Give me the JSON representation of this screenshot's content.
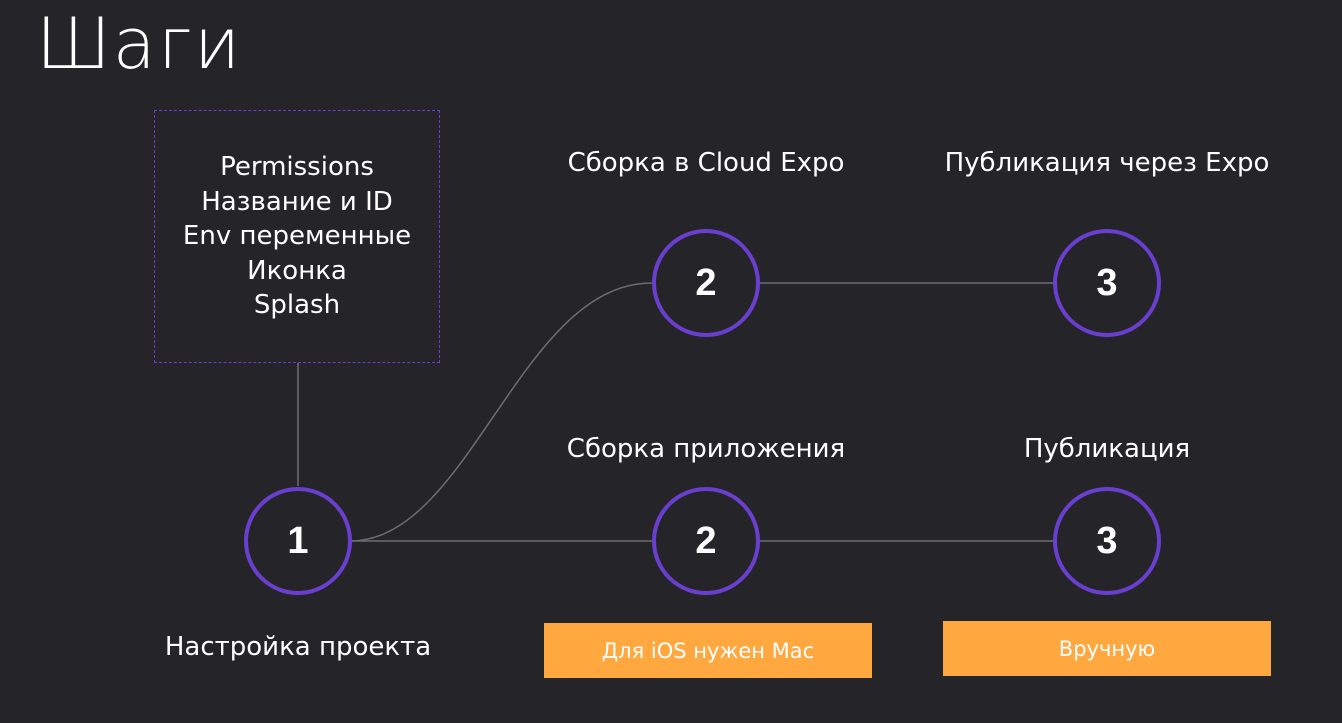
{
  "title": "Шаги",
  "box": {
    "lines": [
      "Permissions",
      "Название и ID",
      "Env переменные",
      "Иконка",
      "Splash"
    ]
  },
  "nodes": {
    "setup": {
      "number": "1",
      "label": "Настройка проекта"
    },
    "cloud_build": {
      "number": "2",
      "label": "Сборка в Cloud Expo"
    },
    "expo_publish": {
      "number": "3",
      "label": "Публикация через Expo"
    },
    "app_build": {
      "number": "2",
      "label": "Сборка приложения"
    },
    "publish": {
      "number": "3",
      "label": "Публикация"
    }
  },
  "tags": {
    "ios_mac": "Для iOS нужен Mac",
    "manual": "Вручную"
  },
  "colors": {
    "background": "#252429",
    "accent": "#6a3fd0",
    "tag": "#ffa840",
    "connector": "#6e6c72"
  }
}
